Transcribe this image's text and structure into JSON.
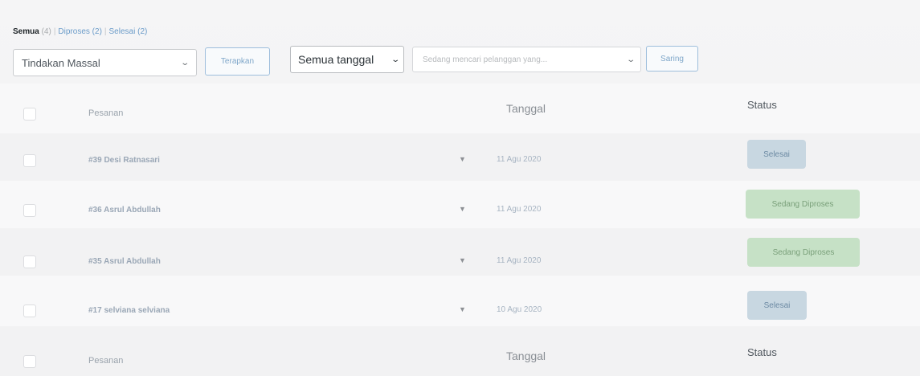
{
  "filters": {
    "all_label": "Semua",
    "all_count": "(4)",
    "processing_label": "Diproses",
    "processing_count": "(2)",
    "completed_label": "Selesai",
    "completed_count": "(2)",
    "separator": "|"
  },
  "tablenav": {
    "bulk_actions": "Tindakan Massal",
    "apply_button": "Terapkan",
    "date_filter": "Semua tanggal",
    "customer_search_placeholder": "Sedang mencari pelanggan yang...",
    "filter_button": "Saring"
  },
  "table": {
    "headers": {
      "order": "Pesanan",
      "date": "Tanggal",
      "status": "Status"
    },
    "footers": {
      "order": "Pesanan",
      "date": "Tanggal",
      "status": "Status"
    },
    "rows": [
      {
        "order": "#39 Desi Ratnasari",
        "date": "11 Agu 2020",
        "status": "Selesai",
        "status_type": "completed"
      },
      {
        "order": "#36 Asrul Abdullah",
        "date": "11 Agu 2020",
        "status": "Sedang Diproses",
        "status_type": "processing"
      },
      {
        "order": "#35 Asrul Abdullah",
        "date": "11 Agu 2020",
        "status": "Sedang Diproses",
        "status_type": "processing"
      },
      {
        "order": "#17 selviana selviana",
        "date": "10 Agu 2020",
        "status": "Selesai",
        "status_type": "completed"
      }
    ],
    "preview_icon": "eye-icon"
  },
  "colors": {
    "completed_badge": "#c8d7e1",
    "processing_badge": "#c6e1c6",
    "link": "#6a9bc9"
  }
}
